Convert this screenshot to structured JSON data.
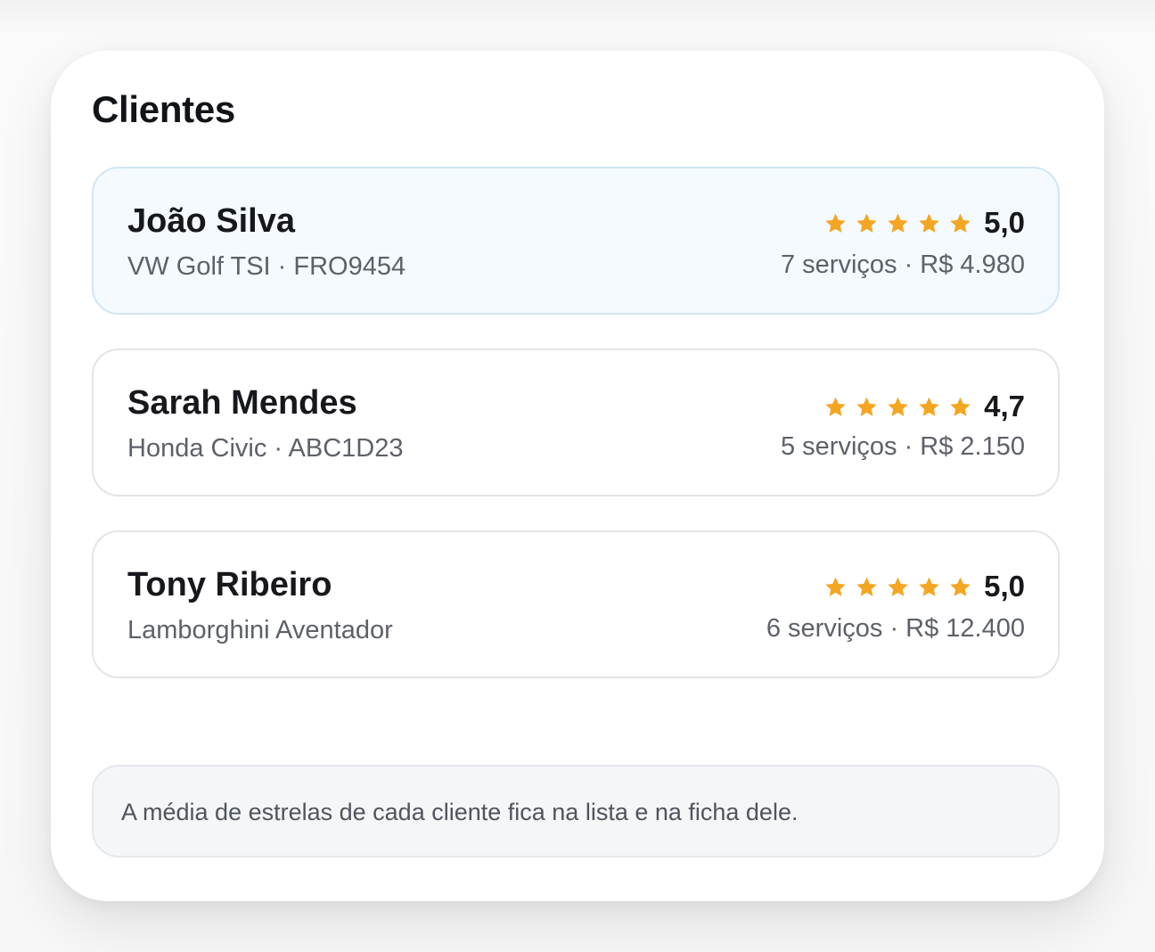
{
  "page": {
    "title": "Clientes"
  },
  "colors": {
    "star": "#f4a521",
    "selected_bg": "#f5fafe",
    "selected_border": "#cfe6f6"
  },
  "clients": [
    {
      "name": "João Silva",
      "vehicle": "VW Golf TSI · FRO9454",
      "rating": "5,0",
      "stars": 5,
      "stats": "7 serviços · R$ 4.980",
      "selected": true
    },
    {
      "name": "Sarah Mendes",
      "vehicle": "Honda Civic · ABC1D23",
      "rating": "4,7",
      "stars": 5,
      "stats": "5 serviços · R$ 2.150",
      "selected": false
    },
    {
      "name": "Tony Ribeiro",
      "vehicle": "Lamborghini Aventador",
      "rating": "5,0",
      "stars": 5,
      "stats": "6 serviços · R$ 12.400",
      "selected": false
    }
  ],
  "note": {
    "text": "A média de estrelas de cada cliente fica na lista e na ficha dele."
  }
}
